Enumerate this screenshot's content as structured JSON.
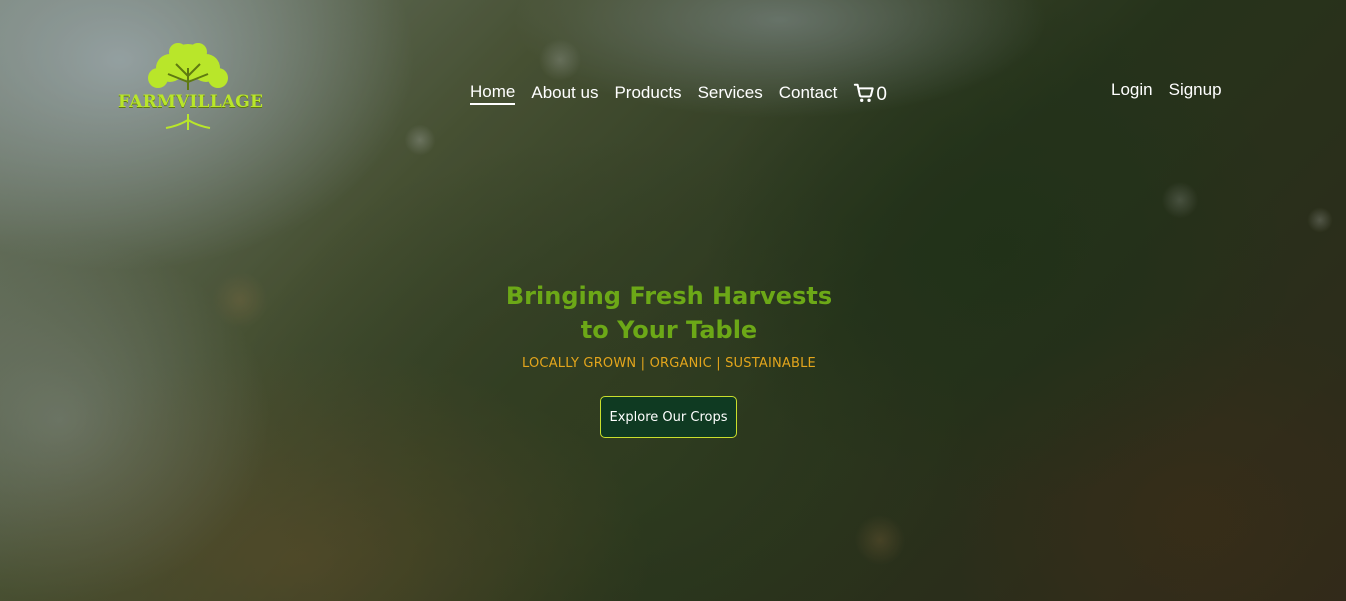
{
  "brand": {
    "name": "FARMVILLAGE",
    "logo_color": "#b9e62a"
  },
  "nav": {
    "items": [
      {
        "label": "Home",
        "active": true
      },
      {
        "label": "About us",
        "active": false
      },
      {
        "label": "Products",
        "active": false
      },
      {
        "label": "Services",
        "active": false
      },
      {
        "label": "Contact",
        "active": false
      }
    ],
    "cart_icon": "shopping-cart-icon",
    "cart_count": "0"
  },
  "auth": {
    "login_label": "Login",
    "signup_label": "Signup"
  },
  "hero": {
    "headline_line1": "Bringing Fresh Harvests",
    "headline_line2": "to Your Table",
    "tagline": "LOCALLY GROWN | ORGANIC | SUSTAINABLE",
    "cta_label": "Explore Our Crops",
    "headline_color": "#6ca817",
    "tagline_color": "#e3a51c",
    "cta_background": "#0f3a22",
    "cta_border": "#c9df2c"
  }
}
